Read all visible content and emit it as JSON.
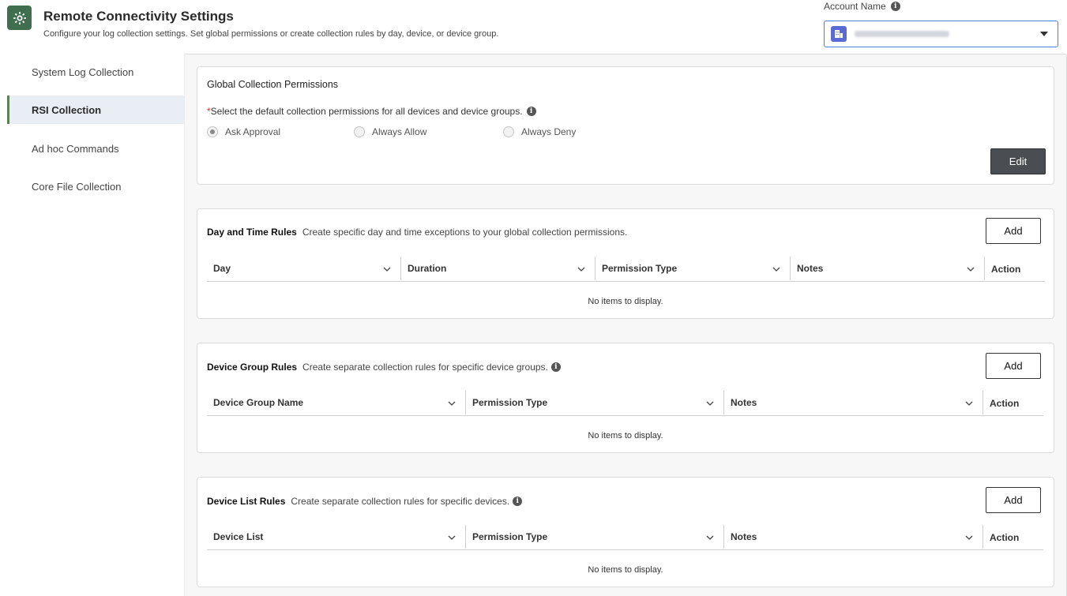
{
  "header": {
    "title": "Remote Connectivity Settings",
    "subtitle": "Configure your log collection settings. Set global permissions or create collection rules by day, device, or device group.",
    "account_label": "Account Name",
    "account_value_redacted": true
  },
  "sidebar": {
    "items": [
      {
        "label": "System Log Collection",
        "active": false
      },
      {
        "label": "RSI Collection",
        "active": true
      },
      {
        "label": "Ad hoc Commands",
        "active": false
      },
      {
        "label": "Core File Collection",
        "active": false
      }
    ]
  },
  "global": {
    "title": "Global Collection Permissions",
    "required_text": "Select the default collection permissions for all devices and device groups.",
    "options": [
      "Ask Approval",
      "Always Allow",
      "Always Deny"
    ],
    "selected": "Ask Approval",
    "edit_label": "Edit"
  },
  "day_time": {
    "title": "Day and Time Rules",
    "desc": "Create specific day and time exceptions to your global collection permissions.",
    "add_label": "Add",
    "columns": [
      "Day",
      "Duration",
      "Permission Type",
      "Notes",
      "Action"
    ],
    "empty": "No items to display."
  },
  "device_group": {
    "title": "Device Group Rules",
    "desc": "Create separate collection rules for specific device groups.",
    "add_label": "Add",
    "columns": [
      "Device Group Name",
      "Permission Type",
      "Notes",
      "Action"
    ],
    "empty": "No items to display."
  },
  "device_list": {
    "title": "Device List Rules",
    "desc": "Create separate collection rules for specific devices.",
    "add_label": "Add",
    "columns": [
      "Device List",
      "Permission Type",
      "Notes",
      "Action"
    ],
    "empty": "No items to display."
  },
  "colors": {
    "accent_green": "#4d8c3f",
    "header_icon_bg": "#3f6f4f",
    "select_border": "#4a7fdc",
    "edit_btn_bg": "#4a4d51"
  }
}
